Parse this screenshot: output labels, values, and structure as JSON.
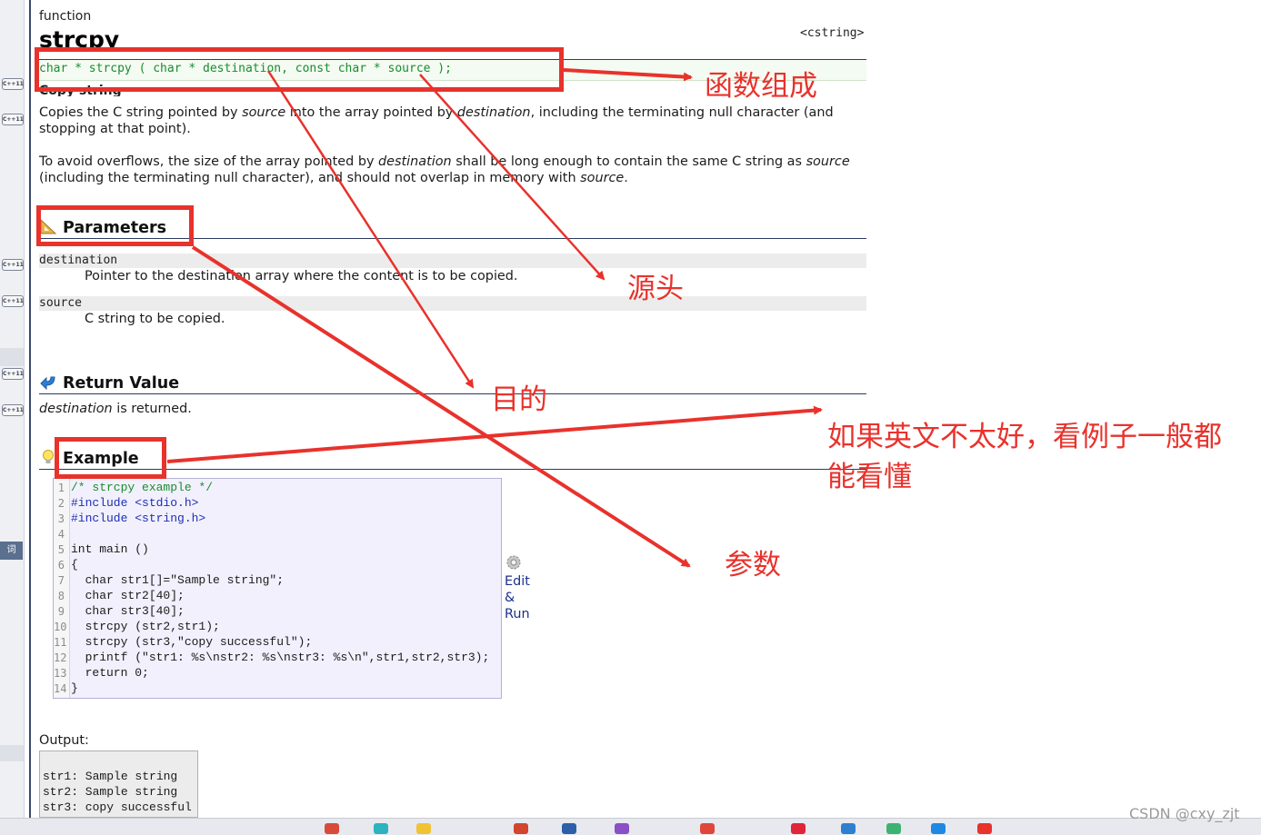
{
  "doc": {
    "kind": "function",
    "name": "strcpy",
    "header_tag": "<cstring>",
    "prototype": "char * strcpy ( char * destination, const char * source );",
    "brief": "Copy string",
    "desc1_parts": [
      "Copies the C string pointed by ",
      "source",
      " into the array pointed by ",
      "destination",
      ", including the terminating null character (and stopping at that point)."
    ],
    "desc2_parts": [
      "To avoid overflows, the size of the array pointed by ",
      "destination",
      " shall be long enough to contain the same C string as ",
      "source",
      " (including the terminating null character), and should not overlap in memory with ",
      "source",
      "."
    ]
  },
  "parameters": {
    "title": "Parameters",
    "items": [
      {
        "name": "destination",
        "desc": "Pointer to the destination array where the content is to be copied."
      },
      {
        "name": "source",
        "desc": "C string to be copied."
      }
    ]
  },
  "return_value": {
    "title": "Return Value",
    "text_parts": [
      "destination",
      " is returned."
    ]
  },
  "example": {
    "title": "Example",
    "lines": [
      "/* strcpy example */",
      "#include <stdio.h>",
      "#include <string.h>",
      "",
      "int main ()",
      "{",
      "  char str1[]=\"Sample string\";",
      "  char str2[40];",
      "  char str3[40];",
      "  strcpy (str2,str1);",
      "  strcpy (str3,\"copy successful\");",
      "  printf (\"str1: %s\\nstr2: %s\\nstr3: %s\\n\",str1,str2,str3);",
      "  return 0;",
      "}"
    ],
    "line_numbers": [
      "1",
      "2",
      "3",
      "4",
      "5",
      "6",
      "7",
      "8",
      "9",
      "10",
      "11",
      "12",
      "13",
      "14"
    ],
    "edit_run": [
      "Edit",
      "&",
      "Run"
    ]
  },
  "output": {
    "label": "Output:",
    "lines": [
      "str1: Sample string",
      "str2: Sample string",
      "str3: copy successful"
    ]
  },
  "annotations": {
    "composition": "函数组成",
    "source": "源头",
    "purpose": "目的",
    "example_tip_line1": "如果英文不太好，看例子一般都",
    "example_tip_line2": "能看懂",
    "params": "参数",
    "color": "#e8322c"
  },
  "sidebar": {
    "badge_label": "C++11",
    "dict_label": "词"
  },
  "watermark": "CSDN @cxy_zjt",
  "colors": {
    "prototype_green": "#1a8c2e",
    "rule_navy": "#2b3b60",
    "code_bg": "#f2f0fc",
    "link_blue": "#1b2f8c"
  }
}
